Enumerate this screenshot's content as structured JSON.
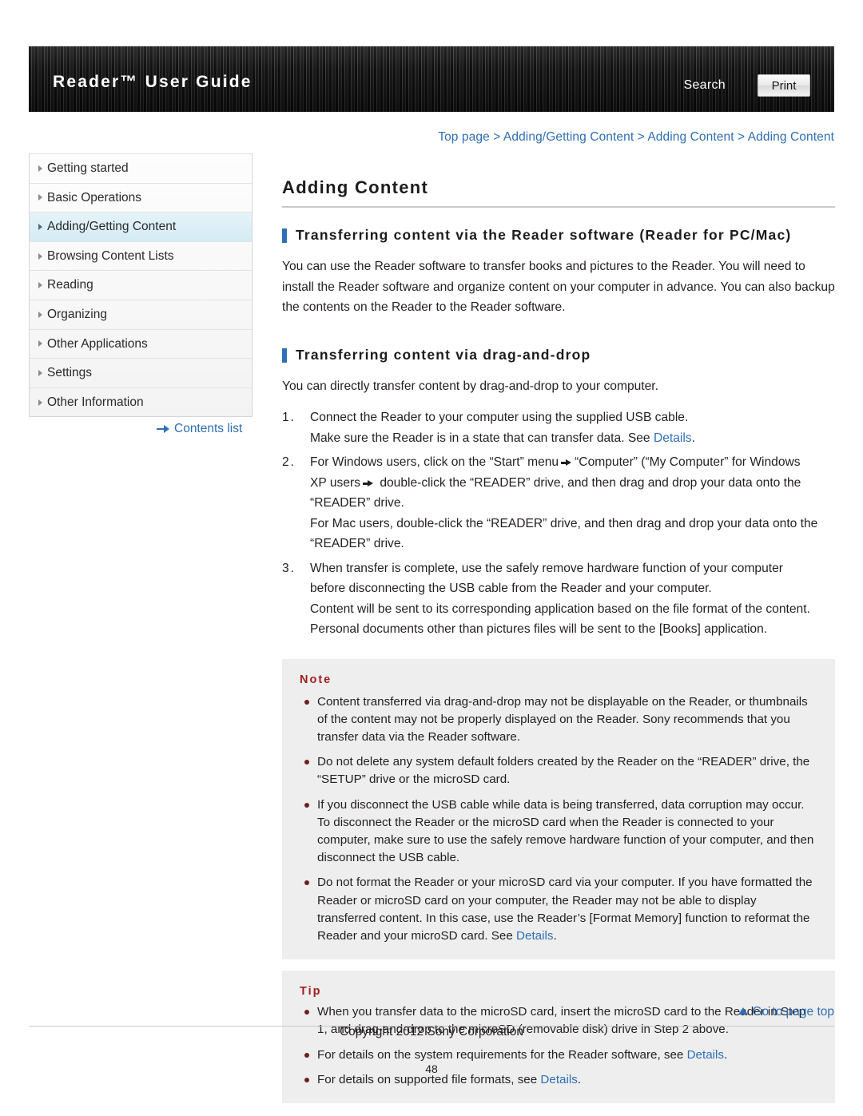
{
  "header": {
    "title": "Reader™ User Guide",
    "search_label": "Search",
    "print_label": "Print"
  },
  "breadcrumb": {
    "text": "Top page > Adding/Getting Content > Adding Content > Adding Content"
  },
  "sidebar": {
    "items": [
      {
        "label": "Getting started",
        "active": false
      },
      {
        "label": "Basic Operations",
        "active": false
      },
      {
        "label": "Adding/Getting Content",
        "active": true
      },
      {
        "label": "Browsing Content Lists",
        "active": false
      },
      {
        "label": "Reading",
        "active": false
      },
      {
        "label": "Organizing",
        "active": false
      },
      {
        "label": "Other Applications",
        "active": false
      },
      {
        "label": "Settings",
        "active": false
      },
      {
        "label": "Other Information",
        "active": false
      }
    ],
    "contents_list_label": "Contents list"
  },
  "main": {
    "page_title": "Adding Content",
    "section1": {
      "heading": "Transferring content via the Reader software (Reader for PC/Mac)",
      "paragraph": "You can use the Reader software to transfer books and pictures to the Reader. You will need to install the Reader software and organize content on your computer in advance. You can also backup the contents on the Reader to the Reader software."
    },
    "section2": {
      "heading": "Transferring content via drag-and-drop",
      "paragraph": "You can directly transfer content by drag-and-drop to your computer.",
      "steps": [
        {
          "num": "1.",
          "line1": "Connect the Reader to your computer using the supplied USB cable.",
          "line2_pre": "Make sure the Reader is in a state that can transfer data. See ",
          "line2_link": "Details",
          "line2_post": "."
        },
        {
          "num": "2.",
          "line1_pre": "For Windows users, click on the “Start” menu",
          "line1_post": "“Computer” (“My Computer” for Windows",
          "line2_pre": "XP users",
          "line2_post": "double-click the “READER” drive, and then drag and drop your data onto the",
          "line3": "“READER” drive.",
          "line4": "For Mac users, double-click the “READER” drive, and then drag and drop your data onto the",
          "line5": "“READER” drive."
        },
        {
          "num": "3.",
          "line1": "When transfer is complete, use the safely remove hardware function of your computer",
          "line2": "before disconnecting the USB cable from the Reader and your computer.",
          "line3": "Content will be sent to its corresponding application based on the file format of the content.",
          "line4": "Personal documents other than pictures files will be sent to the [Books] application."
        }
      ]
    },
    "note": {
      "label": "Note",
      "bullets": [
        {
          "text": "Content transferred via drag-and-drop may not be displayable on the Reader, or thumbnails of the content may not be properly displayed on the Reader. Sony recommends that you transfer data via the Reader software."
        },
        {
          "text": "Do not delete any system default folders created by the Reader on the “READER” drive, the “SETUP” drive or the microSD card."
        },
        {
          "text": "If you disconnect the USB cable while data is being transferred, data corruption may occur. To disconnect the Reader or the microSD card when the Reader is connected to your computer, make sure to use the safely remove hardware function of your computer, and then disconnect the USB cable."
        },
        {
          "pre": "Do not format the Reader or your microSD card via your computer. If you have formatted the Reader or microSD card on your computer, the Reader may not be able to display transferred content. In this case, use the Reader’s [Format Memory] function to reformat the Reader and your microSD card. See ",
          "link": "Details",
          "post": "."
        }
      ]
    },
    "tip": {
      "label": "Tip",
      "bullets": [
        {
          "text": "When you transfer data to the microSD card, insert the microSD card to the Reader in Step 1, and drag-and-drop to the microSD (removable disk) drive in Step 2 above."
        },
        {
          "pre": "For details on the system requirements for the Reader software, see ",
          "link": "Details",
          "post": "."
        },
        {
          "pre": "For details on supported file formats, see ",
          "link": "Details",
          "post": "."
        }
      ]
    }
  },
  "footer": {
    "go_top_label": "Go to page top",
    "copyright": "Copyright 2012 Sony Corporation",
    "page_number": "48"
  }
}
